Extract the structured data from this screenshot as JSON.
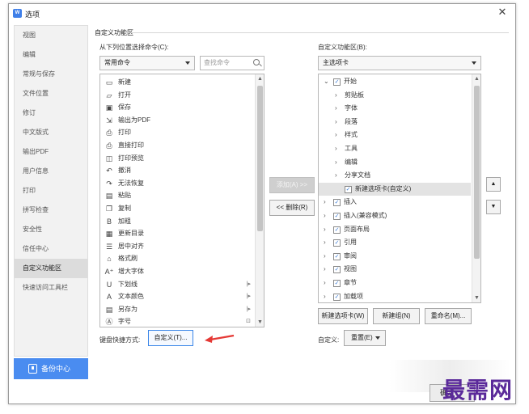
{
  "window": {
    "title": "选项",
    "app_icon_text": "W",
    "close_glyph": "✕"
  },
  "sidebar": {
    "items": [
      {
        "label": "视图"
      },
      {
        "label": "编辑"
      },
      {
        "label": "常规与保存"
      },
      {
        "label": "文件位置"
      },
      {
        "label": "修订"
      },
      {
        "label": "中文版式"
      },
      {
        "label": "输出PDF"
      },
      {
        "label": "用户信息"
      },
      {
        "label": "打印"
      },
      {
        "label": "拼写检查"
      },
      {
        "label": "安全性"
      },
      {
        "label": "信任中心"
      },
      {
        "label": "自定义功能区",
        "active": true
      },
      {
        "label": "快速访问工具栏"
      }
    ],
    "backup_label": "备份中心"
  },
  "section": {
    "title": "自定义功能区"
  },
  "left": {
    "label": "从下列位置选择命令(C):",
    "dropdown_value": "常用命令",
    "search_placeholder": "查找命令",
    "commands": [
      {
        "icon": "▭",
        "label": "新建"
      },
      {
        "icon": "▱",
        "label": "打开"
      },
      {
        "icon": "▣",
        "label": "保存"
      },
      {
        "icon": "⇲",
        "label": "输出为PDF"
      },
      {
        "icon": "⎙",
        "label": "打印"
      },
      {
        "icon": "⎙",
        "label": "直接打印"
      },
      {
        "icon": "◫",
        "label": "打印预览"
      },
      {
        "icon": "↶",
        "label": "撤消"
      },
      {
        "icon": "↷",
        "label": "无法恢复"
      },
      {
        "icon": "▤",
        "label": "粘贴"
      },
      {
        "icon": "❐",
        "label": "复制"
      },
      {
        "icon": "B",
        "label": "加粗"
      },
      {
        "icon": "▦",
        "label": "更新目录"
      },
      {
        "icon": "☰",
        "label": "居中对齐"
      },
      {
        "icon": "⌂",
        "label": "格式刷"
      },
      {
        "icon": "A⁺",
        "label": "增大字体"
      },
      {
        "icon": "U",
        "label": "下划线",
        "sub": "|▸"
      },
      {
        "icon": "A",
        "label": "文本颜色",
        "sub": "|▸"
      },
      {
        "icon": "▤",
        "label": "另存为",
        "sub": "|▸"
      },
      {
        "icon": "Ⓐ",
        "label": "字号",
        "sub": "⊡"
      }
    ],
    "shortcut_label": "键盘快捷方式:",
    "customize_button": "自定义(T)..."
  },
  "middle": {
    "add_button": "添加(A) >>",
    "remove_button": "<< 删除(R)"
  },
  "right": {
    "label": "自定义功能区(B):",
    "dropdown_value": "主选项卡",
    "tree": [
      {
        "level": 0,
        "expanded": true,
        "checked": true,
        "label": "开始"
      },
      {
        "level": 1,
        "label": "剪贴板"
      },
      {
        "level": 1,
        "label": "字体"
      },
      {
        "level": 1,
        "label": "段落"
      },
      {
        "level": 1,
        "label": "样式"
      },
      {
        "level": 1,
        "label": "工具"
      },
      {
        "level": 1,
        "label": "编辑"
      },
      {
        "level": 1,
        "label": "分享文档"
      },
      {
        "level": 1,
        "checked": true,
        "label": "新建选项卡(自定义)",
        "selected": true
      },
      {
        "level": 0,
        "checked": true,
        "label": "插入"
      },
      {
        "level": 0,
        "checked": true,
        "label": "插入(兼容模式)"
      },
      {
        "level": 0,
        "checked": true,
        "label": "页面布局"
      },
      {
        "level": 0,
        "checked": true,
        "label": "引用"
      },
      {
        "level": 0,
        "checked": true,
        "label": "审阅"
      },
      {
        "level": 0,
        "checked": true,
        "label": "视图"
      },
      {
        "level": 0,
        "checked": true,
        "label": "章节"
      },
      {
        "level": 0,
        "checked": true,
        "label": "加载项"
      }
    ],
    "new_tab_button": "新建选项卡(W)",
    "new_group_button": "新建组(N)",
    "rename_button": "重命名(M)...",
    "custom_label": "自定义:",
    "reset_button": "重置(E)",
    "move_up_glyph": "▲",
    "move_down_glyph": "▼"
  },
  "footer": {
    "ok_button": "确定"
  },
  "watermark": "最需网",
  "colors": {
    "accent": "#4a8cf0",
    "highlight_border": "#3a86e8",
    "arrow": "#e53935",
    "watermark": "#5b2a9a"
  }
}
